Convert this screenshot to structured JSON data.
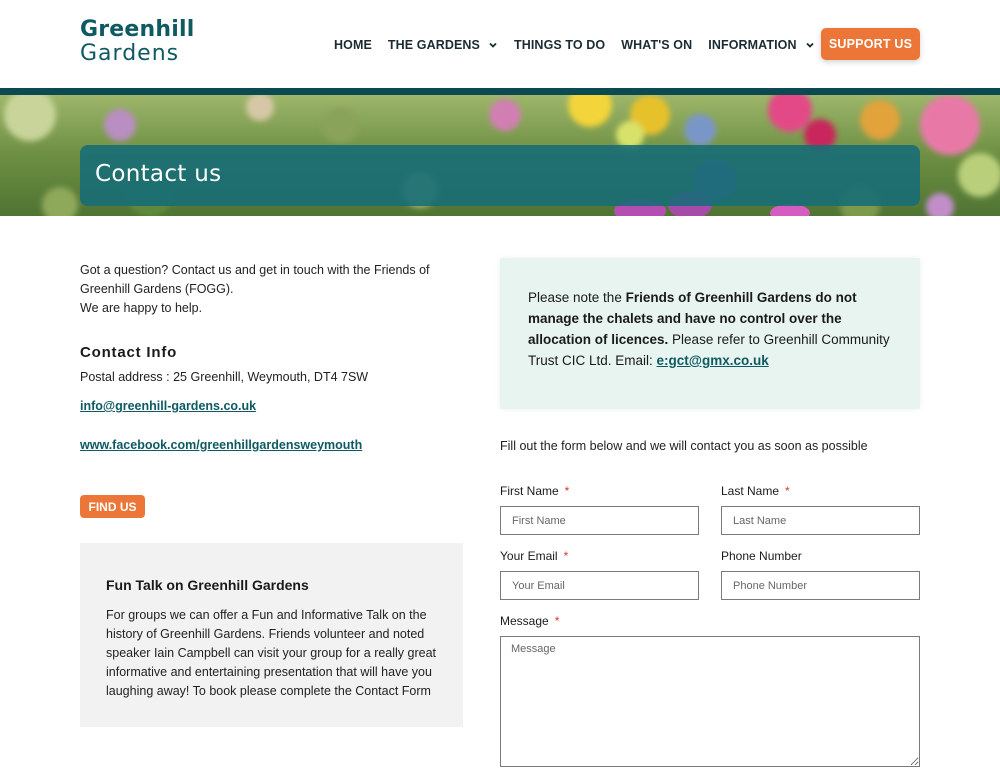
{
  "header": {
    "logo_line1": "Greenhill",
    "logo_line2": "Gardens",
    "nav": [
      {
        "label": "HOME",
        "has_dropdown": false
      },
      {
        "label": "THE GARDENS",
        "has_dropdown": true
      },
      {
        "label": "THINGS TO DO",
        "has_dropdown": false
      },
      {
        "label": "WHAT'S ON",
        "has_dropdown": false
      },
      {
        "label": "INFORMATION",
        "has_dropdown": true
      }
    ],
    "support_label": "SUPPORT US"
  },
  "hero": {
    "title": "Contact us"
  },
  "left": {
    "intro_line1": "Got a question? Contact us and get in touch with the Friends of Greenhill Gardens (FOGG).",
    "intro_line2": "We are happy to help.",
    "contact_heading": "Contact  Info",
    "postal": "Postal address : 25 Greenhill, Weymouth, DT4 7SW",
    "email": "info@greenhill-gardens.co.uk",
    "facebook": "www.facebook.com/greenhillgardensweymouth",
    "find_us_label": "FIND US",
    "talk": {
      "title": "Fun Talk on Greenhill Gardens",
      "body": "For groups we can offer a Fun and Informative Talk on the history of Greenhill Gardens. Friends volunteer and noted speaker Iain Campbell can visit your group for a really great informative and entertaining presentation that will have you laughing away! To book please complete the Contact Form"
    }
  },
  "note": {
    "prefix": "Please note the ",
    "bold": "Friends of Greenhill Gardens do not manage the chalets and have no control over the allocation of licences.",
    "suffix": " Please refer to Greenhill Community Trust CIC Ltd. Email: ",
    "link": "e:gct@gmx.co.uk"
  },
  "form": {
    "intro": "Fill out the form below and we will contact you as soon as possible",
    "required_marker": "*",
    "first_name": {
      "label": "First Name",
      "placeholder": "First Name",
      "value": ""
    },
    "last_name": {
      "label": "Last Name",
      "placeholder": "Last Name",
      "value": ""
    },
    "email": {
      "label": "Your Email",
      "placeholder": "Your Email",
      "value": ""
    },
    "phone": {
      "label": "Phone Number",
      "placeholder": "Phone Number",
      "value": ""
    },
    "message": {
      "label": "Message",
      "placeholder": "Message",
      "value": ""
    }
  },
  "colors": {
    "brand_teal": "#0f5a62",
    "accent_orange": "#ec7638",
    "note_bg": "#e8f4ef",
    "talk_bg": "#f3f2f2"
  }
}
